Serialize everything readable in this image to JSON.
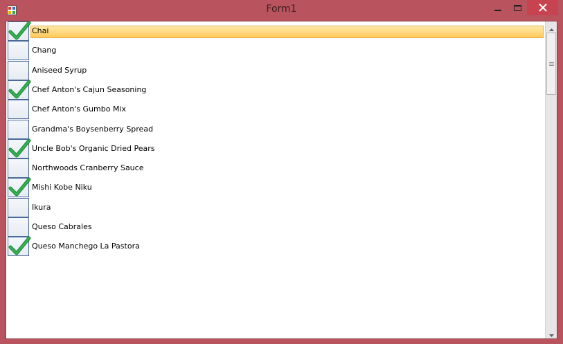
{
  "window": {
    "title": "Form1",
    "accent": "#b9535e",
    "close_hover": "#c7434f"
  },
  "icons": {
    "app": "app-icon",
    "minimize": "minimize-icon",
    "maximize": "maximize-icon",
    "close": "close-icon",
    "check": "checkmark-icon",
    "scroll_up": "arrow-up-icon",
    "scroll_down": "arrow-down-icon"
  },
  "list": {
    "selected_index": 0,
    "items": [
      {
        "label": "Chai",
        "checked": true
      },
      {
        "label": "Chang",
        "checked": false
      },
      {
        "label": "Aniseed Syrup",
        "checked": false
      },
      {
        "label": "Chef Anton's Cajun Seasoning",
        "checked": true
      },
      {
        "label": "Chef Anton's Gumbo Mix",
        "checked": false
      },
      {
        "label": "Grandma's Boysenberry Spread",
        "checked": false
      },
      {
        "label": "Uncle Bob's Organic Dried Pears",
        "checked": true
      },
      {
        "label": "Northwoods Cranberry Sauce",
        "checked": false
      },
      {
        "label": "Mishi Kobe Niku",
        "checked": true
      },
      {
        "label": "Ikura",
        "checked": false
      },
      {
        "label": "Queso Cabrales",
        "checked": false
      },
      {
        "label": "Queso Manchego La Pastora",
        "checked": true
      }
    ]
  }
}
